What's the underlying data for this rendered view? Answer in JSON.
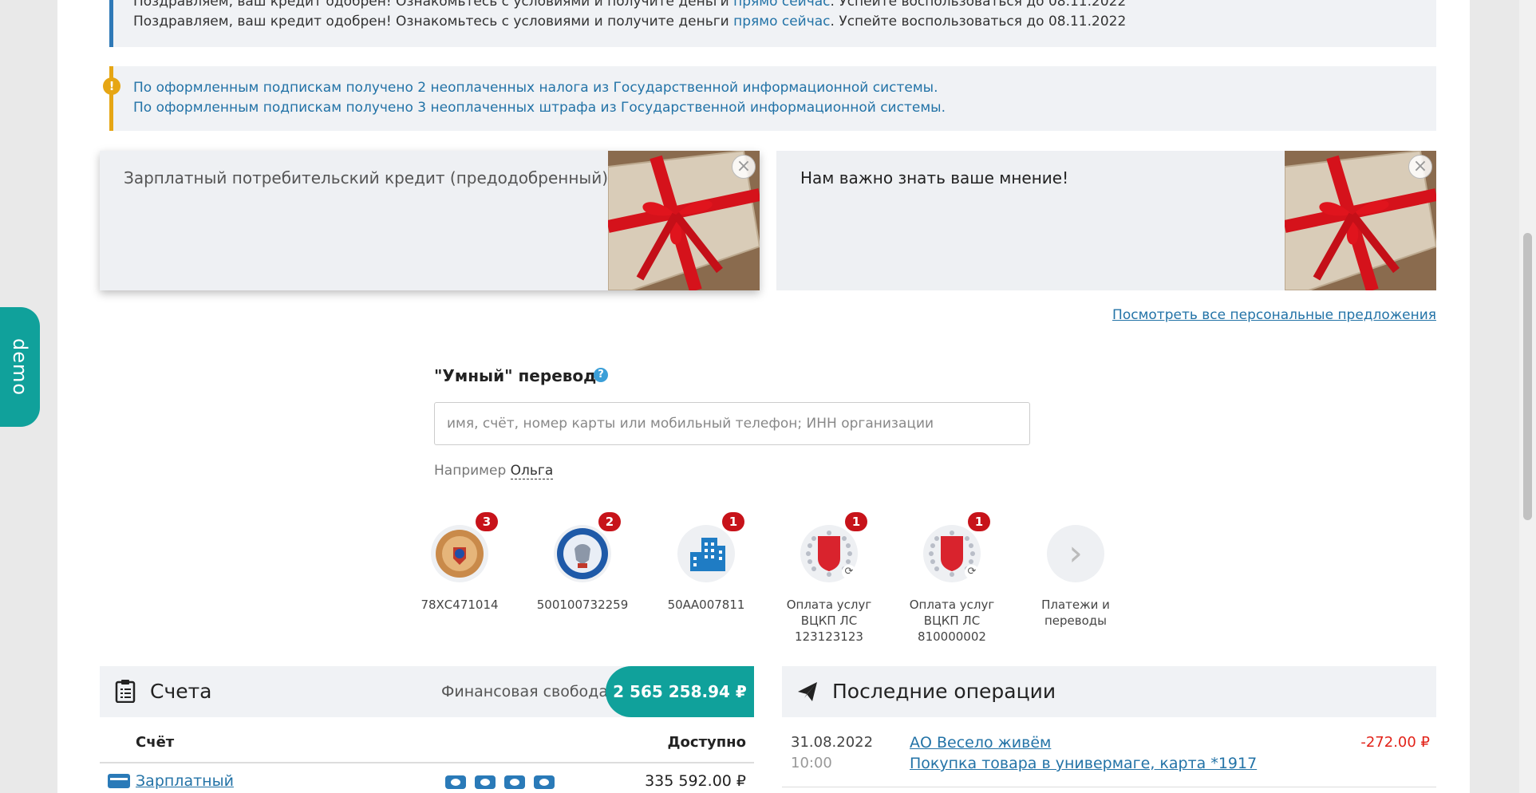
{
  "notices": {
    "credit_line_prefix": "Поздравляем, ваш кредит одобрен! Ознакомьтесь с условиями и получите деньги ",
    "credit_link": "прямо сейчас",
    "credit_line_suffix": ". Успейте воспользоваться до 08.11.2022",
    "tax_line": "По оформленным подпискам получено 2 неоплаченных налога из Государственной информационной системы.",
    "fine_line": "По оформленным подпискам получено 3 неоплаченных штрафа из Государственной информационной системы."
  },
  "offers": [
    {
      "title": "Зарплатный потребительский кредит (предодобренный)"
    },
    {
      "title": "Нам важно знать ваше мнение!"
    }
  ],
  "offers_link": "Посмотреть все персональные предложения",
  "demo_tab": "demo",
  "smart_transfer": {
    "title": "\"Умный\" перевод",
    "help_icon": "?",
    "placeholder": "имя, счёт, номер карты или мобильный телефон; ИНН организации",
    "example_prefix": "Например",
    "example_name": "Ольга"
  },
  "quick_payments": [
    {
      "icon": "traffic-police-emblem-icon",
      "badge": "3",
      "label": "78ХС471014"
    },
    {
      "icon": "tax-service-emblem-icon",
      "badge": "2",
      "label": "500100732259"
    },
    {
      "icon": "building-icon",
      "badge": "1",
      "label": "50АА007811"
    },
    {
      "icon": "shield-coat-of-arms-icon",
      "badge": "1",
      "label": "Оплата услуг ВЦКП ЛС 123123123"
    },
    {
      "icon": "shield-coat-of-arms-icon",
      "badge": "1",
      "label": "Оплата услуг ВЦКП ЛС 810000002"
    },
    {
      "icon": "chevron-right-icon",
      "badge": "",
      "label": "Платежи и переводы"
    }
  ],
  "accounts": {
    "title": "Счета",
    "fin_label": "Финансовая свобода",
    "fin_total": "2 565 258.94 ₽",
    "col_account": "Счёт",
    "col_available": "Доступно",
    "rows": [
      {
        "name": "Зарплатный",
        "amount": "335 592.00 ₽"
      }
    ]
  },
  "operations": {
    "title": "Последние операции",
    "rows": [
      {
        "date": "31.08.2022",
        "time": "10:00",
        "title": "АО Весело живём",
        "desc": "Покупка товара в универмаге, карта *1917",
        "amount": "-272.00 ₽"
      }
    ]
  },
  "colors": {
    "accent": "#10a19b",
    "link": "#2373a7",
    "warning": "#e6a614",
    "info": "#2f79b7",
    "badge": "#c7131a",
    "negative": "#e2231a"
  }
}
